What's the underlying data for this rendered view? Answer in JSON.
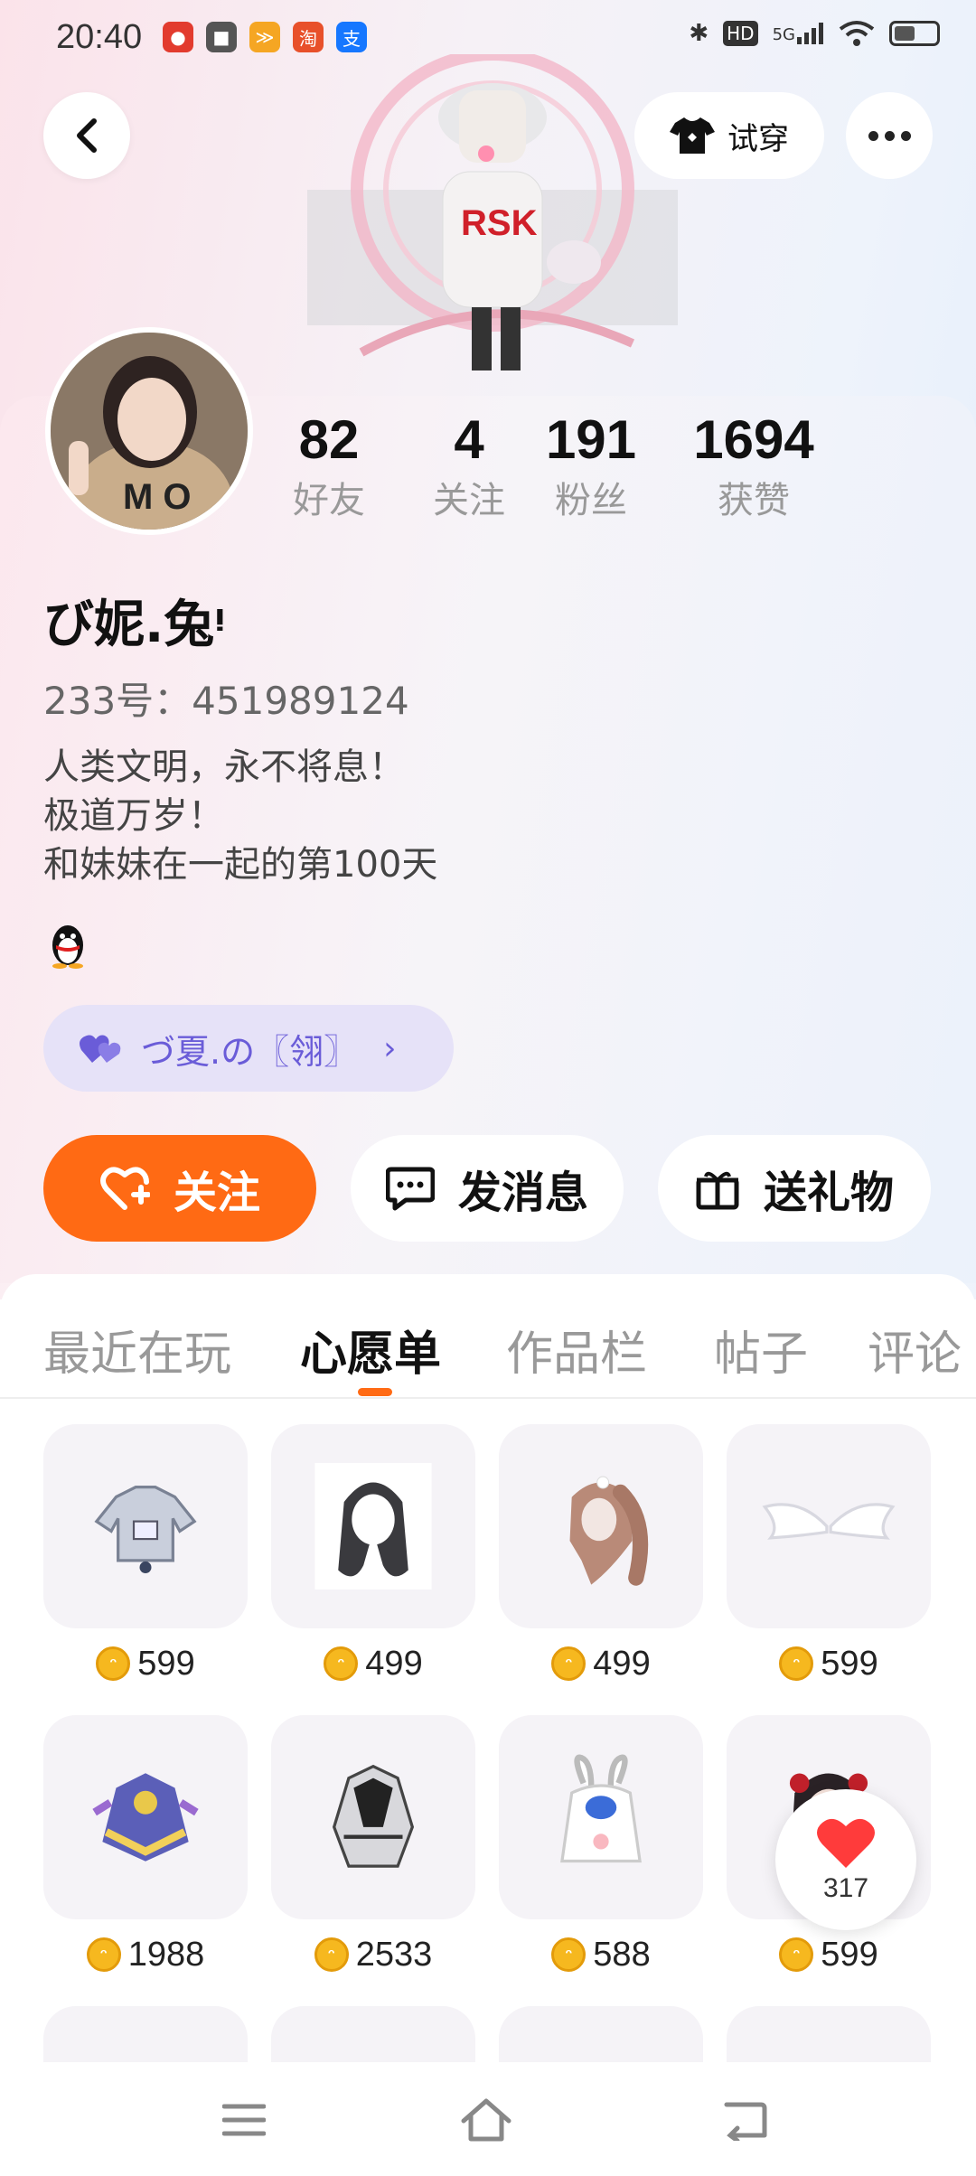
{
  "status_bar": {
    "time": "20:40",
    "apps": [
      {
        "icon": "app-red-icon",
        "glyph": "●",
        "color": "#e23b2e"
      },
      {
        "icon": "video-icon",
        "glyph": "■",
        "color": "#555555"
      },
      {
        "icon": "app-orange-icon",
        "glyph": "≫",
        "color": "#f5a623"
      },
      {
        "icon": "taobao-icon",
        "glyph": "淘",
        "color": "#e8502a"
      },
      {
        "icon": "alipay-icon",
        "glyph": "支",
        "color": "#1677ff"
      }
    ],
    "hd_label": "HD",
    "network_label": "5G"
  },
  "header": {
    "tryon_label": "试穿"
  },
  "profile": {
    "stats": [
      {
        "value": "82",
        "label": "好友"
      },
      {
        "value": "4",
        "label": "关注"
      },
      {
        "value": "191",
        "label": "粉丝"
      },
      {
        "value": "1694",
        "label": "获赞"
      }
    ],
    "username": "び妮.兔ᵎ",
    "user_id": "233号：451989124",
    "bio_lines": [
      "人类文明，永不将息！",
      "极道万岁！",
      "和妹妹在一起的第100天"
    ],
    "partner_label": "づ夏.の〖翎〗"
  },
  "actions": {
    "follow_label": "关注",
    "message_label": "发消息",
    "gift_label": "送礼物"
  },
  "tabs": [
    {
      "label": "最近在玩",
      "active": false
    },
    {
      "label": "心愿单",
      "active": true
    },
    {
      "label": "作品栏",
      "active": false
    },
    {
      "label": "帖子",
      "active": false
    },
    {
      "label": "评论",
      "active": false
    }
  ],
  "wishlist": [
    {
      "item": "outfit-jacket",
      "price": "599"
    },
    {
      "item": "hair-long-dark",
      "price": "499"
    },
    {
      "item": "hair-ponytail",
      "price": "499"
    },
    {
      "item": "angel-wings",
      "price": "599"
    },
    {
      "item": "costume-dress",
      "price": "1988"
    },
    {
      "item": "outfit-dark-dress",
      "price": "2533"
    },
    {
      "item": "bunny-hoodie",
      "price": "588"
    },
    {
      "item": "hair-bun-bows",
      "price": "599"
    }
  ],
  "like_float": {
    "count": "317"
  },
  "colors": {
    "accent": "#ff6a14",
    "partner": "#6a5cd8",
    "coin": "#f6b81f"
  }
}
